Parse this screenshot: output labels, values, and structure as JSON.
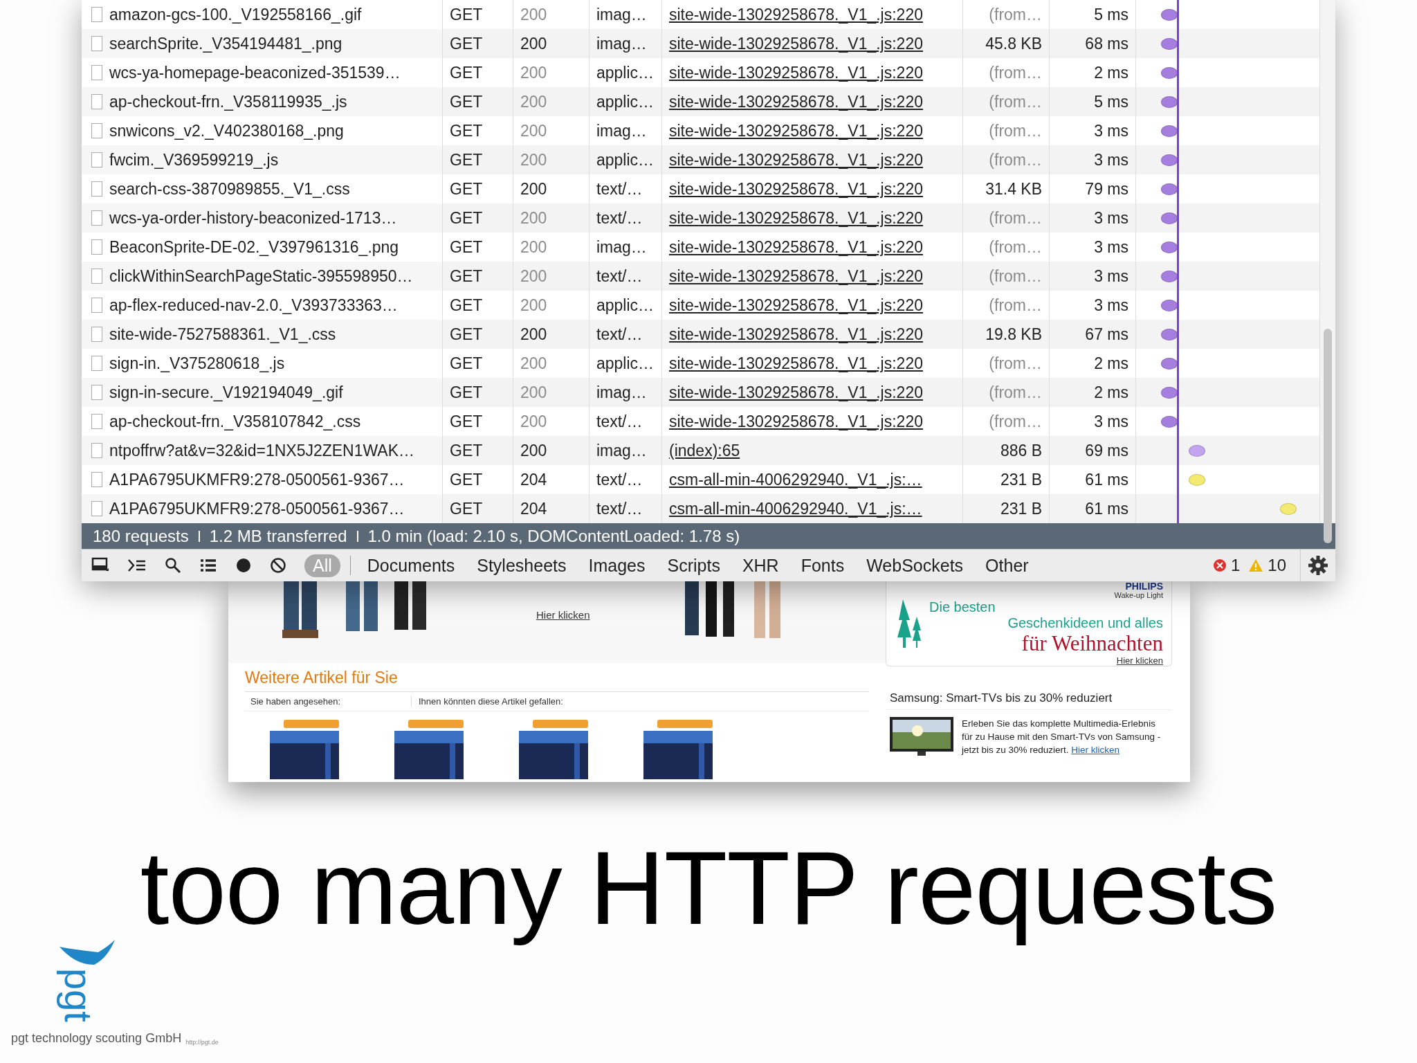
{
  "network_panel": {
    "rows": [
      {
        "name": "amazon-gcs-100._V192558166_.gif",
        "method": "GET",
        "status": "200",
        "type": "imag…",
        "initiator": "site-wide-13029258678._V1_.js:220",
        "size": "(from…",
        "time": "5 ms",
        "cached": true,
        "color": "#a67ee0",
        "kind": "early"
      },
      {
        "name": "searchSprite._V354194481_.png",
        "method": "GET",
        "status": "200",
        "type": "imag…",
        "initiator": "site-wide-13029258678._V1_.js:220",
        "size": "45.8 KB",
        "time": "68 ms",
        "cached": false,
        "color": "#a67ee0",
        "kind": "early"
      },
      {
        "name": "wcs-ya-homepage-beaconized-351539…",
        "method": "GET",
        "status": "200",
        "type": "applic…",
        "initiator": "site-wide-13029258678._V1_.js:220",
        "size": "(from…",
        "time": "2 ms",
        "cached": true,
        "color": "#a67ee0",
        "kind": "early"
      },
      {
        "name": "ap-checkout-frn._V358119935_.js",
        "method": "GET",
        "status": "200",
        "type": "applic…",
        "initiator": "site-wide-13029258678._V1_.js:220",
        "size": "(from…",
        "time": "5 ms",
        "cached": true,
        "color": "#a67ee0",
        "kind": "early"
      },
      {
        "name": "snwicons_v2._V402380168_.png",
        "method": "GET",
        "status": "200",
        "type": "imag…",
        "initiator": "site-wide-13029258678._V1_.js:220",
        "size": "(from…",
        "time": "3 ms",
        "cached": true,
        "color": "#a67ee0",
        "kind": "early"
      },
      {
        "name": "fwcim._V369599219_.js",
        "method": "GET",
        "status": "200",
        "type": "applic…",
        "initiator": "site-wide-13029258678._V1_.js:220",
        "size": "(from…",
        "time": "3 ms",
        "cached": true,
        "color": "#a67ee0",
        "kind": "early"
      },
      {
        "name": "search-css-3870989855._V1_.css",
        "method": "GET",
        "status": "200",
        "type": "text/…",
        "initiator": "site-wide-13029258678._V1_.js:220",
        "size": "31.4 KB",
        "time": "79 ms",
        "cached": false,
        "color": "#a67ee0",
        "kind": "early"
      },
      {
        "name": "wcs-ya-order-history-beaconized-1713…",
        "method": "GET",
        "status": "200",
        "type": "text/…",
        "initiator": "site-wide-13029258678._V1_.js:220",
        "size": "(from…",
        "time": "3 ms",
        "cached": true,
        "color": "#a67ee0",
        "kind": "early"
      },
      {
        "name": "BeaconSprite-DE-02._V397961316_.png",
        "method": "GET",
        "status": "200",
        "type": "imag…",
        "initiator": "site-wide-13029258678._V1_.js:220",
        "size": "(from…",
        "time": "3 ms",
        "cached": true,
        "color": "#a67ee0",
        "kind": "early"
      },
      {
        "name": "clickWithinSearchPageStatic-395598950…",
        "method": "GET",
        "status": "200",
        "type": "text/…",
        "initiator": "site-wide-13029258678._V1_.js:220",
        "size": "(from…",
        "time": "3 ms",
        "cached": true,
        "color": "#a67ee0",
        "kind": "early"
      },
      {
        "name": "ap-flex-reduced-nav-2.0._V393733363…",
        "method": "GET",
        "status": "200",
        "type": "applic…",
        "initiator": "site-wide-13029258678._V1_.js:220",
        "size": "(from…",
        "time": "3 ms",
        "cached": true,
        "color": "#a67ee0",
        "kind": "early"
      },
      {
        "name": "site-wide-7527588361._V1_.css",
        "method": "GET",
        "status": "200",
        "type": "text/…",
        "initiator": "site-wide-13029258678._V1_.js:220",
        "size": "19.8 KB",
        "time": "67 ms",
        "cached": false,
        "color": "#a67ee0",
        "kind": "early"
      },
      {
        "name": "sign-in._V375280618_.js",
        "method": "GET",
        "status": "200",
        "type": "applic…",
        "initiator": "site-wide-13029258678._V1_.js:220",
        "size": "(from…",
        "time": "2 ms",
        "cached": true,
        "color": "#a67ee0",
        "kind": "early"
      },
      {
        "name": "sign-in-secure._V192194049_.gif",
        "method": "GET",
        "status": "200",
        "type": "imag…",
        "initiator": "site-wide-13029258678._V1_.js:220",
        "size": "(from…",
        "time": "2 ms",
        "cached": true,
        "color": "#a67ee0",
        "kind": "early"
      },
      {
        "name": "ap-checkout-frn._V358107842_.css",
        "method": "GET",
        "status": "200",
        "type": "text/…",
        "initiator": "site-wide-13029258678._V1_.js:220",
        "size": "(from…",
        "time": "3 ms",
        "cached": true,
        "color": "#a67ee0",
        "kind": "early"
      },
      {
        "name": "ntpoffrw?at&v=32&id=1NX5J2ZEN1WAK…",
        "method": "GET",
        "status": "200",
        "type": "imag…",
        "initiator": "(index):65",
        "size": "886 B",
        "time": "69 ms",
        "cached": false,
        "color": "#c3a4ee",
        "kind": "late"
      },
      {
        "name": "A1PA6795UKMFR9:278-0500561-9367…",
        "method": "GET",
        "status": "204",
        "type": "text/…",
        "initiator": "csm-all-min-4006292940._V1_.js:…",
        "size": "231 B",
        "time": "61 ms",
        "cached": false,
        "color": "#f3ea72",
        "kind": "late"
      },
      {
        "name": "A1PA6795UKMFR9:278-0500561-9367…",
        "method": "GET",
        "status": "204",
        "type": "text/…",
        "initiator": "csm-all-min-4006292940._V1_.js:…",
        "size": "231 B",
        "time": "61 ms",
        "cached": false,
        "color": "#f3ea72",
        "kind": "last"
      }
    ],
    "status_bar": [
      "180 requests",
      "1.2 MB transferred",
      "1.0 min (load: 2.10 s, DOMContentLoaded: 1.78 s)"
    ],
    "filters": [
      {
        "label": "All",
        "selected": true
      },
      {
        "label": "Documents",
        "selected": false
      },
      {
        "label": "Stylesheets",
        "selected": false
      },
      {
        "label": "Images",
        "selected": false
      },
      {
        "label": "Scripts",
        "selected": false
      },
      {
        "label": "XHR",
        "selected": false
      },
      {
        "label": "Fonts",
        "selected": false
      },
      {
        "label": "WebSockets",
        "selected": false
      },
      {
        "label": "Other",
        "selected": false
      }
    ],
    "error_count": "1",
    "warning_count": "10"
  },
  "web_page": {
    "banner_link": "Hier klicken",
    "ad": {
      "brand": "PHILIPS",
      "product": "Wake-up Light",
      "line_1": "Die besten",
      "line_2": "Geschenkideen und alles",
      "line_3": "für Weihnachten",
      "link": "Hier klicken"
    },
    "section_title": "Weitere Artikel für Sie",
    "viewed_label": "Sie haben angesehen:",
    "suggest_label": "Ihnen könnten diese Artikel gefallen:",
    "promo": {
      "title": "Samsung: Smart-TVs bis zu 30% reduziert",
      "text": "Erleben Sie das komplette Multimedia-Erlebnis für zu Hause mit den Smart-TVs von Samsung - jetzt bis zu 30% reduziert.",
      "link": "Hier klicken"
    }
  },
  "slide": {
    "title": "too many HTTP requests",
    "logo_text": "pgt",
    "logo_url": "http://pgt.de",
    "company": "pgt technology scouting GmbH"
  }
}
